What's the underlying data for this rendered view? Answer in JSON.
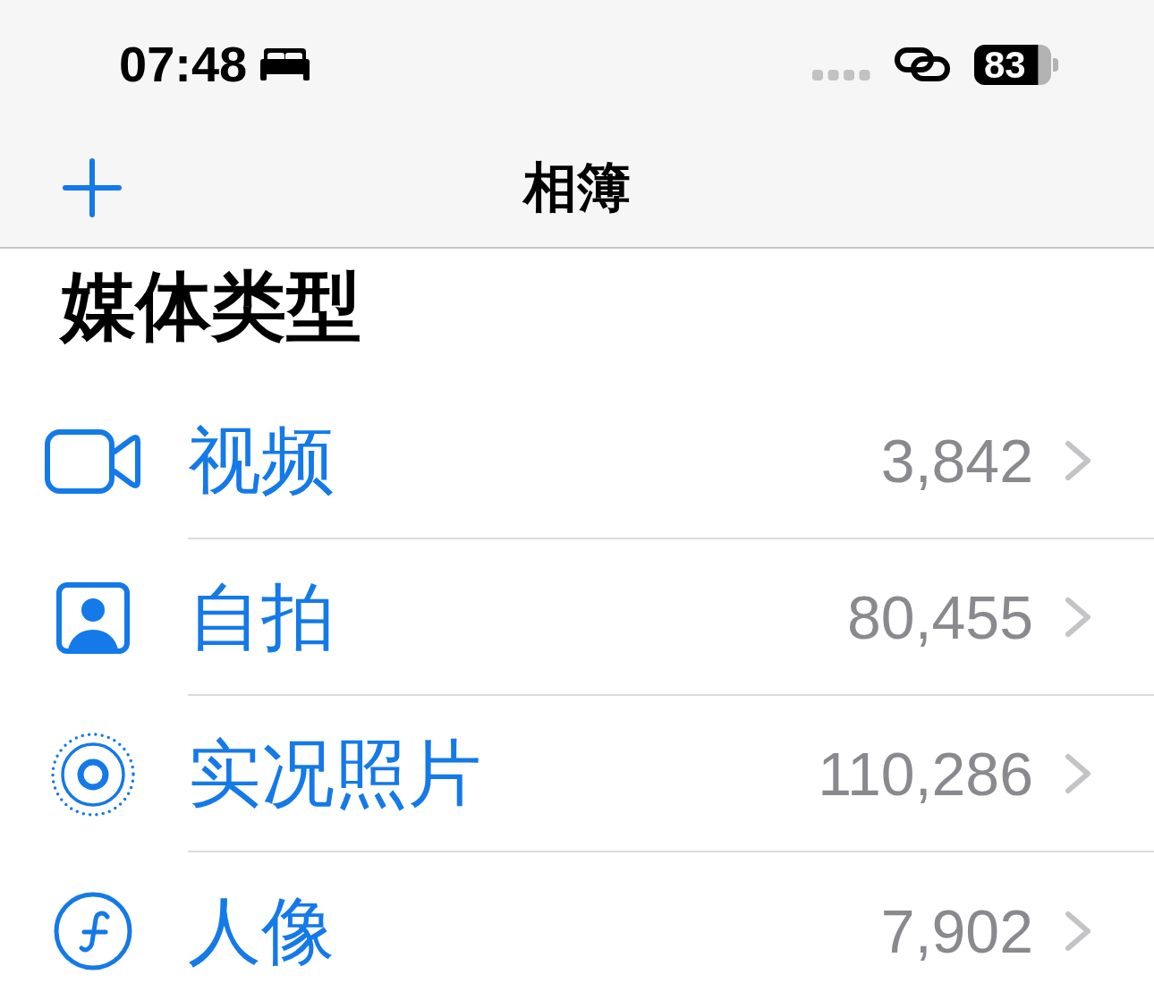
{
  "status_bar": {
    "time": "07:48",
    "battery": "83"
  },
  "nav_bar": {
    "title": "相簿"
  },
  "section": {
    "title": "媒体类型",
    "items": [
      {
        "kind": "video",
        "label": "视频",
        "count": "3,842"
      },
      {
        "kind": "selfie",
        "label": "自拍",
        "count": "80,455"
      },
      {
        "kind": "live",
        "label": "实况照片",
        "count": "110,286"
      },
      {
        "kind": "portrait",
        "label": "人像",
        "count": "7,902"
      }
    ]
  }
}
